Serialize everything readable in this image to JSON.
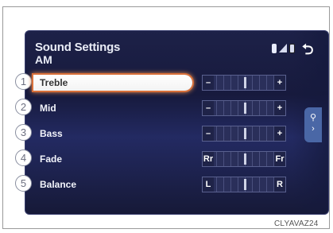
{
  "header": {
    "title": "Sound Settings",
    "source": "AM"
  },
  "items": [
    {
      "num": "1",
      "label": "Treble",
      "left": "–",
      "right": "+",
      "level": 0.5,
      "selected": true
    },
    {
      "num": "2",
      "label": "Mid",
      "left": "–",
      "right": "+",
      "level": 0.5,
      "selected": false
    },
    {
      "num": "3",
      "label": "Bass",
      "left": "–",
      "right": "+",
      "level": 0.5,
      "selected": false
    },
    {
      "num": "4",
      "label": "Fade",
      "left": "Rr",
      "right": "Fr",
      "level": 0.5,
      "selected": false
    },
    {
      "num": "5",
      "label": "Balance",
      "left": "L",
      "right": "R",
      "level": 0.5,
      "selected": false
    }
  ],
  "caption": "CLYAVAZ24",
  "icons": {
    "bluetooth": "bluetooth-icon",
    "signal": "signal-icon",
    "phone": "phone-battery-icon",
    "back": "back-arrow-icon",
    "side": "search-tab-icon"
  },
  "colors": {
    "screen_bg": "#1d2148",
    "selected_highlight": "#d9703a",
    "text": "#f2f4fb",
    "tab": "#4a67a6"
  }
}
